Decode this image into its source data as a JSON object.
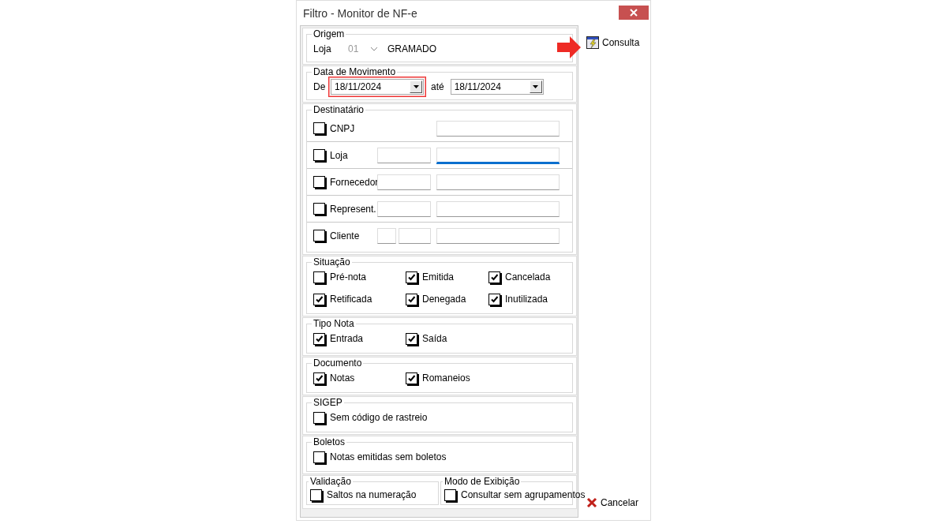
{
  "window": {
    "title": "Filtro - Monitor de NF-e"
  },
  "origem": {
    "title": "Origem",
    "label": "Loja",
    "store_code": "01",
    "store_disabled": true,
    "store_name": "GRAMADO"
  },
  "data_movimento": {
    "title": "Data de Movimento",
    "from_label": "De",
    "from": "18/11/2024",
    "from_highlighted": true,
    "to_label": "até",
    "to": "18/11/2024"
  },
  "destinatario": {
    "title": "Destinatário",
    "rows": [
      {
        "label": "CNPJ",
        "checked": false,
        "fields": [
          {
            "kind": "large_offset",
            "focused": false
          }
        ]
      },
      {
        "label": "Loja",
        "checked": false,
        "fields": [
          {
            "kind": "small",
            "focused": false
          },
          {
            "kind": "large",
            "focused": true
          }
        ]
      },
      {
        "label": "Fornecedor",
        "checked": false,
        "fields": [
          {
            "kind": "small",
            "focused": false
          },
          {
            "kind": "large",
            "focused": false
          }
        ]
      },
      {
        "label": "Represent.",
        "checked": false,
        "fields": [
          {
            "kind": "small",
            "focused": false
          },
          {
            "kind": "large",
            "focused": false
          }
        ]
      },
      {
        "label": "Cliente",
        "checked": false,
        "fields": [
          {
            "kind": "tiny",
            "focused": false
          },
          {
            "kind": "tiny2",
            "focused": false
          },
          {
            "kind": "large",
            "focused": false
          }
        ]
      }
    ]
  },
  "checkbox_groups": [
    {
      "title": "Situação",
      "items": [
        {
          "label": "Pré-nota",
          "checked": false
        },
        {
          "label": "Emitida",
          "checked": true
        },
        {
          "label": "Cancelada",
          "checked": true
        },
        {
          "label": "Retificada",
          "checked": true
        },
        {
          "label": "Denegada",
          "checked": true
        },
        {
          "label": "Inutilizada",
          "checked": true
        }
      ]
    },
    {
      "title": "Tipo Nota",
      "items": [
        {
          "label": "Entrada",
          "checked": true
        },
        {
          "label": "Saída",
          "checked": true
        }
      ]
    },
    {
      "title": "Documento",
      "items": [
        {
          "label": "Notas",
          "checked": true
        },
        {
          "label": "Romaneios",
          "checked": true
        }
      ]
    },
    {
      "title": "SIGEP",
      "items": [
        {
          "label": "Sem código de rastreio",
          "checked": false
        }
      ]
    },
    {
      "title": "Boletos",
      "items": [
        {
          "label": "Notas emitidas sem boletos",
          "checked": false
        }
      ]
    }
  ],
  "bottom_groups": [
    {
      "title": "Validação",
      "items": [
        {
          "label": "Saltos na numeração",
          "checked": false
        }
      ]
    },
    {
      "title": "Modo de Exibição",
      "items": [
        {
          "label": "Consultar sem agrupamentos",
          "checked": false
        }
      ]
    }
  ],
  "buttons": {
    "search": "Consulta",
    "cancel": "Cancelar"
  }
}
